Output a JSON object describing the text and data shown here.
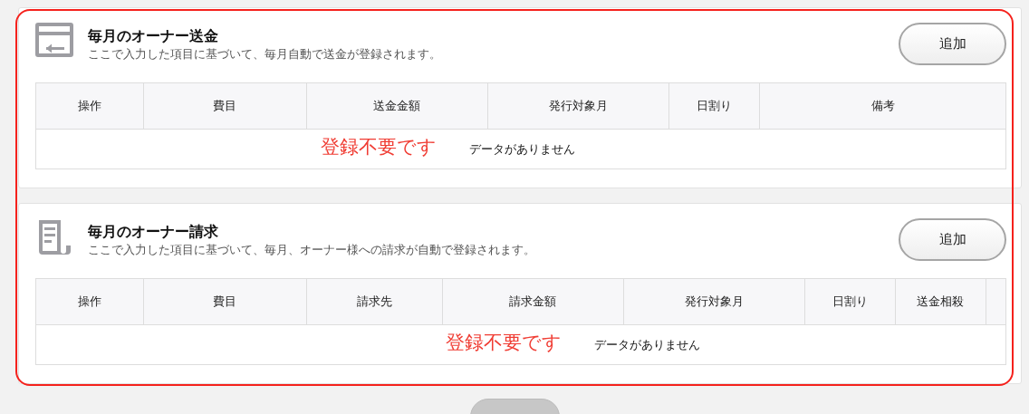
{
  "sections": [
    {
      "kind": "remit",
      "title": "毎月のオーナー送金",
      "description": "ここで入力した項目に基づいて、毎月自動で送金が登録されます。",
      "add_button": "追加",
      "columns": [
        "操作",
        "費目",
        "送金金額",
        "発行対象月",
        "日割り",
        "備考"
      ],
      "empty_message": "データがありません",
      "annotation": "登録不要です"
    },
    {
      "kind": "invoice",
      "title": "毎月のオーナー請求",
      "description": "ここで入力した項目に基づいて、毎月、オーナー様への請求が自動で登録されます。",
      "add_button": "追加",
      "columns": [
        "操作",
        "費目",
        "請求先",
        "請求金額",
        "発行対象月",
        "日割り",
        "送金相殺",
        ""
      ],
      "empty_message": "データがありません",
      "annotation": "登録不要です"
    }
  ]
}
